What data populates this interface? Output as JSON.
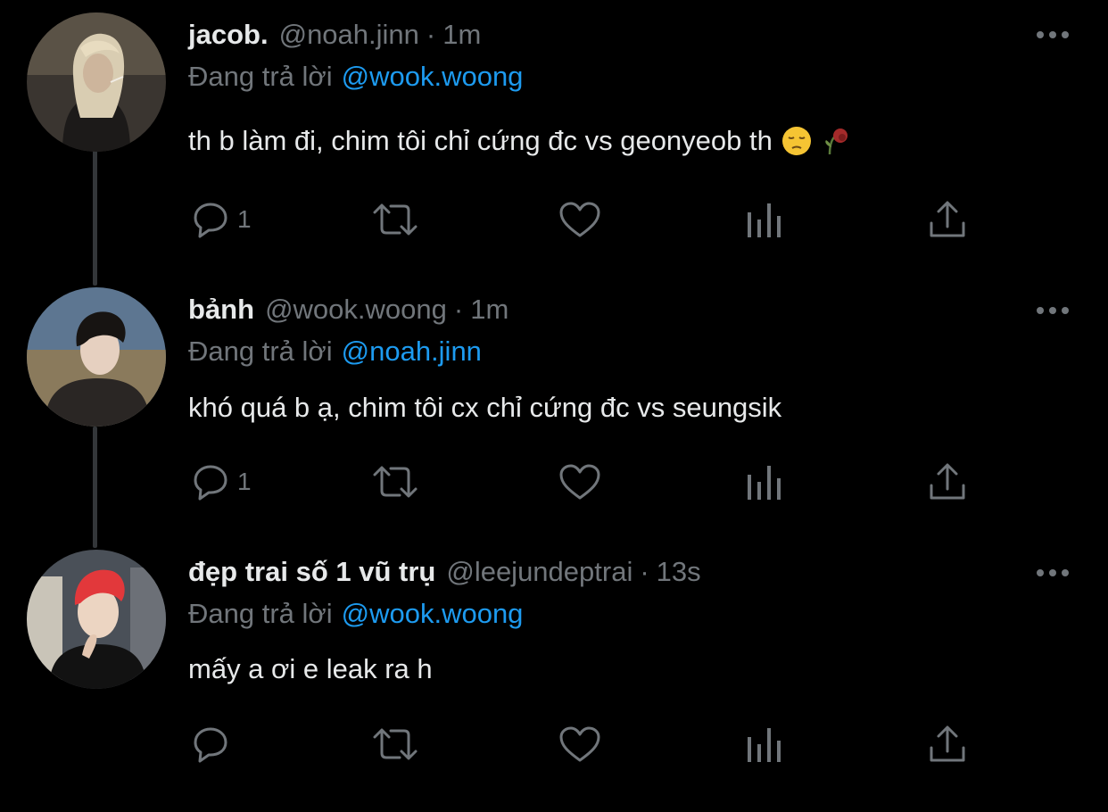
{
  "colors": {
    "background": "#000000",
    "primary_text": "#e7e9ea",
    "secondary_text": "#71767b",
    "link": "#1d9bf0",
    "thread_line": "#333639"
  },
  "tweets": [
    {
      "name": "jacob.",
      "handle": "@noah.jinn",
      "separator": "·",
      "time": "1m",
      "reply_prefix": "Đang trả lời",
      "reply_to": "@wook.woong",
      "text": "th b làm đi, chim tôi chỉ cứng đc vs geonyeob th",
      "emoji": [
        "pensive-face-emoji",
        "wilted-flower-emoji"
      ],
      "reply_count": "1"
    },
    {
      "name": "bảnh",
      "handle": "@wook.woong",
      "separator": "·",
      "time": "1m",
      "reply_prefix": "Đang trả lời",
      "reply_to": "@noah.jinn",
      "text": "khó quá b ạ, chim tôi cx chỉ cứng đc vs seungsik",
      "reply_count": "1"
    },
    {
      "name": "đẹp trai số 1 vũ trụ",
      "handle": "@leejundeptrai",
      "separator": "·",
      "time": "13s",
      "reply_prefix": "Đang trả lời",
      "reply_to": "@wook.woong",
      "text": "mấy a ơi e leak ra h",
      "reply_count": ""
    }
  ],
  "icons": {
    "reply": "reply-bubble-icon",
    "retweet": "retweet-icon",
    "like": "heart-icon",
    "views": "analytics-bars-icon",
    "share": "share-upload-icon",
    "more": "more-dots-icon"
  }
}
